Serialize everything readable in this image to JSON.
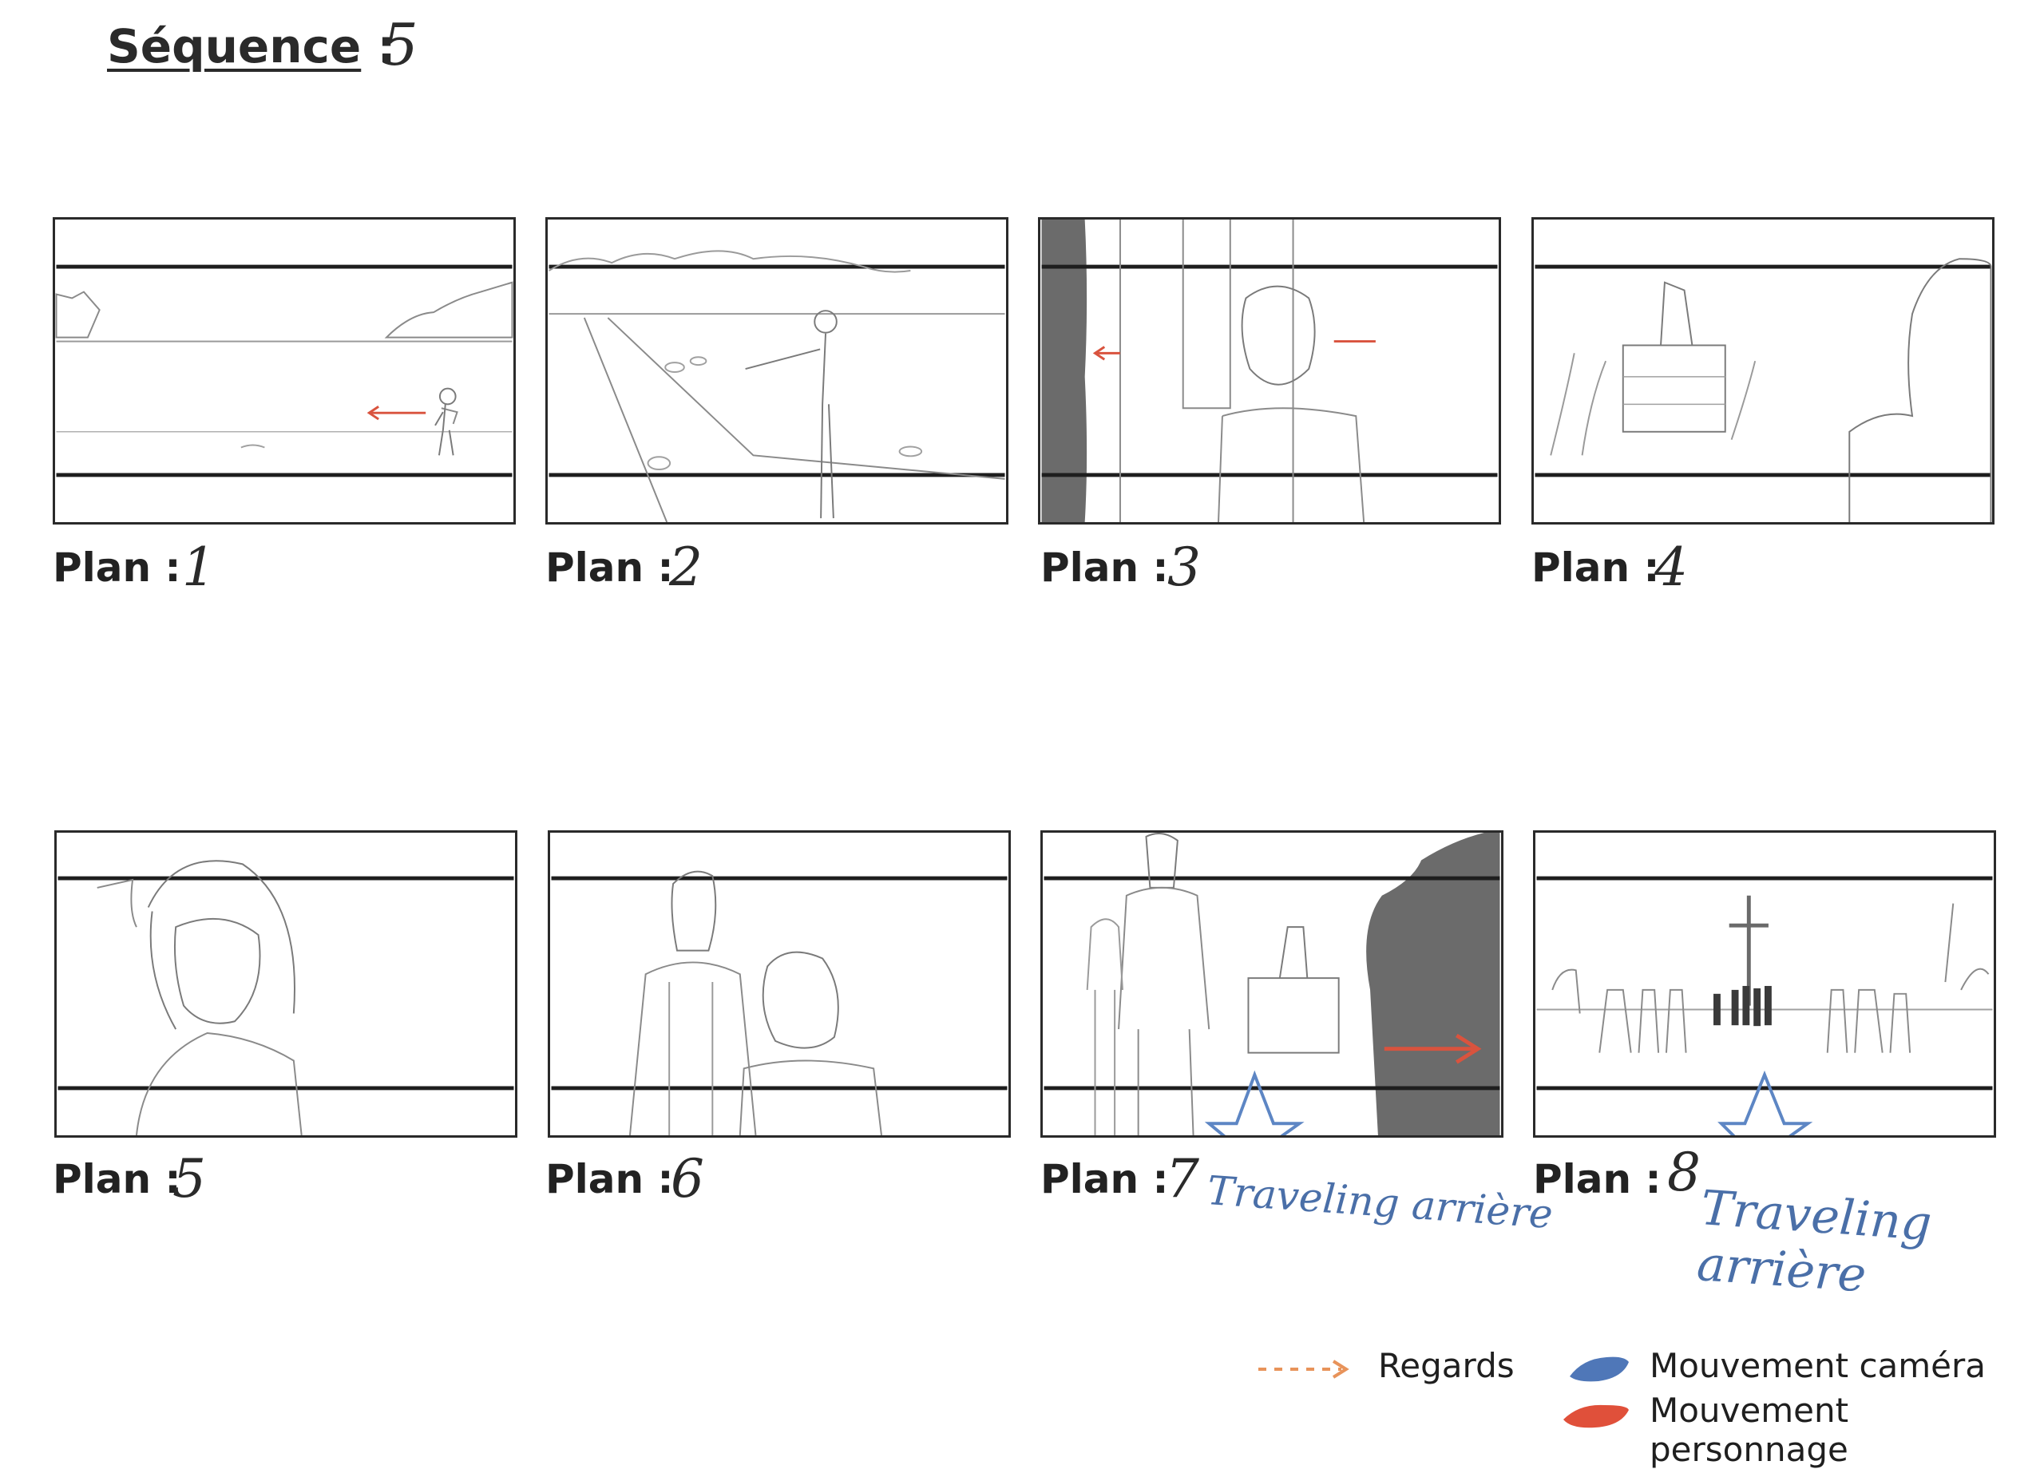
{
  "header": {
    "sequence_label": "Séquence",
    "sequence_colon": ":",
    "sequence_value": "5"
  },
  "plan_label": "Plan :",
  "panels": [
    {
      "number": "1",
      "note": ""
    },
    {
      "number": "2",
      "note": ""
    },
    {
      "number": "3",
      "note": ""
    },
    {
      "number": "4",
      "note": ""
    },
    {
      "number": "5",
      "note": ""
    },
    {
      "number": "6",
      "note": ""
    },
    {
      "number": "7",
      "note": "Traveling arrière"
    },
    {
      "number": "8",
      "note": "Traveling arrière"
    }
  ],
  "legend": {
    "gaze_label": "Regards",
    "camera_label": "Mouvement caméra",
    "character_label": "Mouvement personnage",
    "gaze_color": "#e8935a",
    "camera_color": "#4f77b8",
    "character_color": "#e0503a"
  },
  "colors": {
    "frame": "#2a2a2a",
    "dark_fill": "#6b6b6b",
    "sketch": "#8a8a8a",
    "character_arrow": "#d9533e",
    "camera_arrow": "#5d86c4"
  }
}
